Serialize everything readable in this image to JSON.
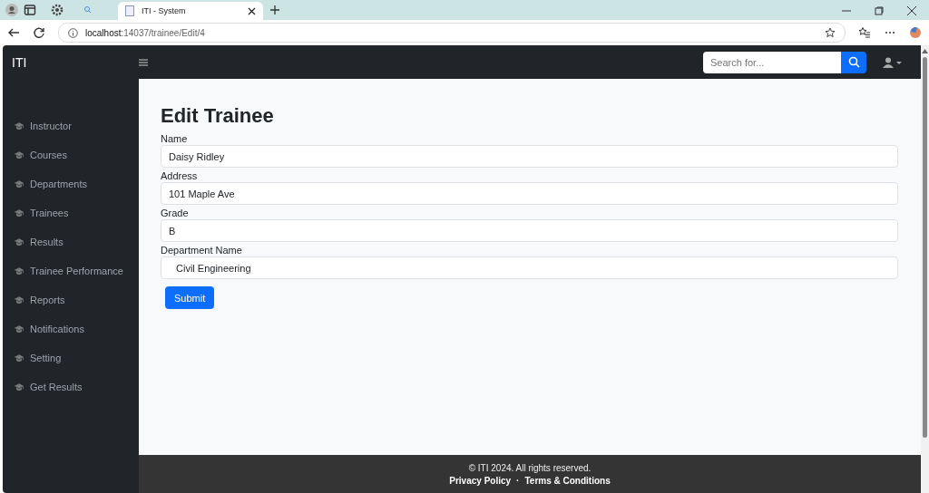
{
  "browser": {
    "tabs": [
      {
        "title": "ITI - System",
        "selected": true
      }
    ],
    "address": {
      "host": "localhost",
      "path": ":14037/trainee/Edit/4"
    }
  },
  "navbar": {
    "brand": "ITI",
    "search": {
      "placeholder": "Search for..."
    }
  },
  "sidebar": {
    "items": [
      {
        "label": "Instructor"
      },
      {
        "label": "Courses"
      },
      {
        "label": "Departments"
      },
      {
        "label": "Trainees"
      },
      {
        "label": "Results"
      },
      {
        "label": "Trainee Performance"
      },
      {
        "label": "Reports"
      },
      {
        "label": "Notifications"
      },
      {
        "label": "Setting"
      },
      {
        "label": "Get Results"
      }
    ]
  },
  "page_title": "Edit Trainee",
  "fields": [
    {
      "label": "Name",
      "value": "Daisy Ridley",
      "kind": "input"
    },
    {
      "label": "Address",
      "value": "101 Maple Ave",
      "kind": "input"
    },
    {
      "label": "Grade",
      "value": "B",
      "kind": "input"
    },
    {
      "label": "Department Name",
      "value": "Civil Engineering",
      "kind": "select"
    }
  ],
  "submit": "Submit",
  "footer": {
    "copyright": "© ITI 2024. All rights reserved.",
    "links": [
      "Privacy Policy",
      "Terms & Conditions"
    ],
    "separator": "·"
  }
}
